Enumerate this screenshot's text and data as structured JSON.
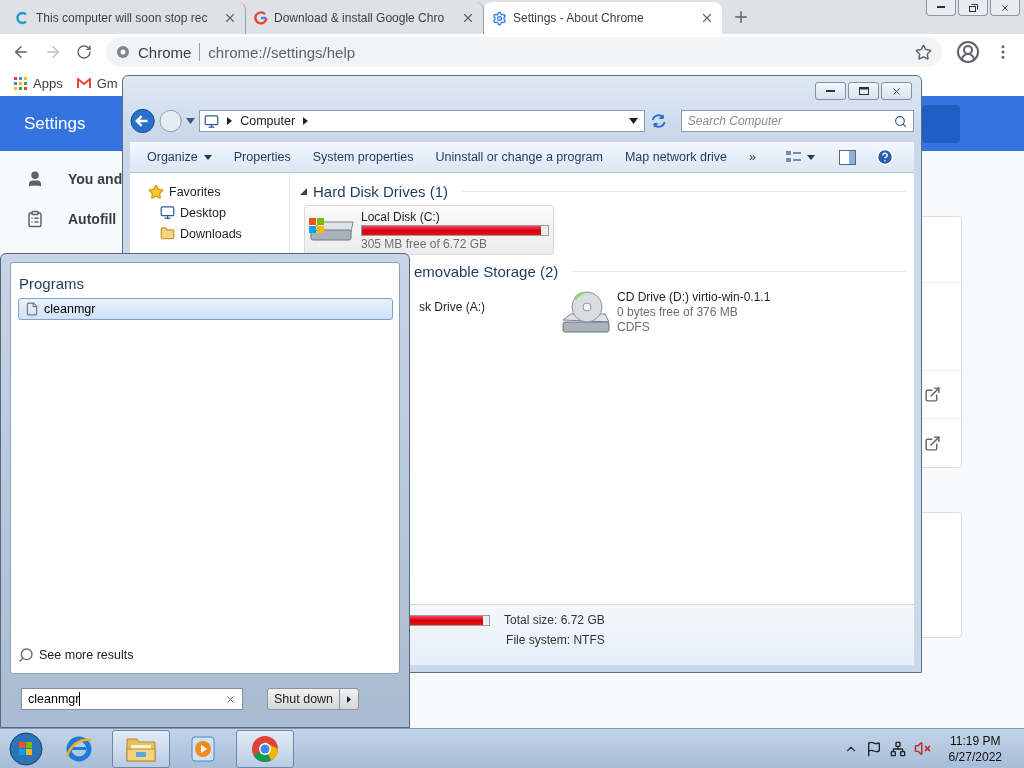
{
  "browser": {
    "tabs": [
      {
        "title": "This computer will soon stop rec",
        "selected": false,
        "kind": "c"
      },
      {
        "title": "Download & install Google Chro",
        "selected": false,
        "kind": "g"
      },
      {
        "title": "Settings - About Chrome",
        "selected": true,
        "kind": "gear"
      }
    ],
    "omnibox": {
      "site": "Chrome",
      "url": "chrome://settings/help"
    },
    "bookmarks": [
      {
        "label": "Apps",
        "kind": "apps"
      },
      {
        "label": "Gm",
        "kind": "mail"
      }
    ]
  },
  "settings": {
    "title": "Settings",
    "nav": [
      {
        "label": "You and",
        "kind": "person"
      },
      {
        "label": "Autofill",
        "kind": "clipboard"
      }
    ]
  },
  "explorer": {
    "address": "Computer",
    "search": {
      "placeholder": "Search Computer"
    },
    "toolbar": [
      {
        "label": "Organize",
        "kind": "menu"
      },
      {
        "label": "Properties",
        "kind": "action"
      },
      {
        "label": "System properties",
        "kind": "action"
      },
      {
        "label": "Uninstall or change a program",
        "kind": "action"
      },
      {
        "label": "Map network drive",
        "kind": "action"
      },
      {
        "label": "»",
        "kind": "action"
      }
    ],
    "favorites": {
      "title": "Favorites",
      "items": [
        "Desktop",
        "Downloads"
      ]
    },
    "groups": [
      {
        "title": "Hard Disk Drives (1)",
        "expanded": true,
        "drives": [
          {
            "kind": "disk",
            "name": "Local Disk (C:)",
            "level": 0.96,
            "free": "305 MB free of 6.72 GB",
            "selected": true
          }
        ]
      },
      {
        "title": "emovable Storage (2)",
        "drives": [
          {
            "kind": "floppy",
            "name": "sk Drive (A:)",
            "selected": false
          },
          {
            "kind": "cd",
            "name": "CD Drive (D:) virtio-win-0.1.1",
            "free": "0 bytes free of 376 MB",
            "fs": "CDFS",
            "selected": false
          }
        ]
      }
    ],
    "details": {
      "level": 0.96,
      "total": "Total size: 6.72 GB",
      "fs": "File system: NTFS"
    }
  },
  "start_menu": {
    "section": "Programs",
    "results": [
      {
        "label": "cleanmgr",
        "selected": true
      }
    ],
    "more": "See more results",
    "search": {
      "value": "cleanmgr"
    },
    "shutdown": "Shut down"
  },
  "taskbar": {
    "apps": [
      {
        "kind": "ie",
        "running": false
      },
      {
        "kind": "folder",
        "running": true
      },
      {
        "kind": "media",
        "running": false
      },
      {
        "kind": "chrome",
        "running": true
      }
    ],
    "time": "11:19 PM",
    "date": "6/27/2022"
  }
}
